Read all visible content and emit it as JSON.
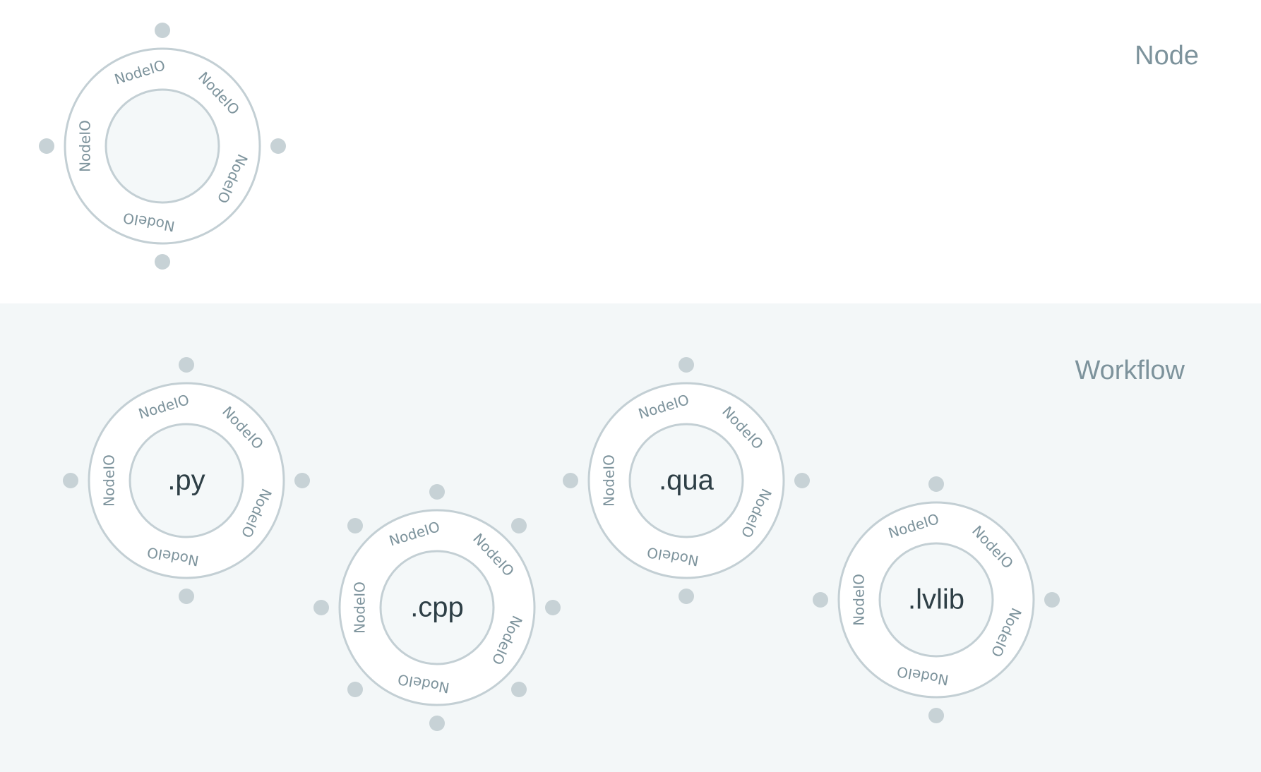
{
  "sections": {
    "node": {
      "label": "Node"
    },
    "workflow": {
      "label": "Workflow"
    }
  },
  "nodes": [
    {
      "id": "node-base",
      "center_label": "",
      "ports": 4,
      "io_labels": [
        "NodeIO",
        "NodeIO",
        "NodeIO",
        "NodeIO",
        "NodeIO"
      ]
    },
    {
      "id": "workflow-py",
      "center_label": ".py",
      "ports": 4,
      "io_labels": [
        "NodeIO",
        "NodeIO",
        "NodeIO",
        "NodeIO",
        "NodeIO"
      ]
    },
    {
      "id": "workflow-cpp",
      "center_label": ".cpp",
      "ports": 8,
      "io_labels": [
        "NodeIO",
        "NodeIO",
        "NodeIO",
        "NodeIO",
        "NodeIO"
      ]
    },
    {
      "id": "workflow-qua",
      "center_label": ".qua",
      "ports": 4,
      "io_labels": [
        "NodeIO",
        "NodeIO",
        "NodeIO",
        "NodeIO",
        "NodeIO"
      ]
    },
    {
      "id": "workflow-lvlib",
      "center_label": ".lvlib",
      "ports": 4,
      "io_labels": [
        "NodeIO",
        "NodeIO",
        "NodeIO",
        "NodeIO",
        "NodeIO"
      ]
    }
  ],
  "colors": {
    "label": "#7d939c",
    "ring_stroke": "#c3cfd4",
    "port": "#c7d2d6",
    "center_text": "#2e3f46",
    "workflow_bg": "#f3f7f8"
  }
}
